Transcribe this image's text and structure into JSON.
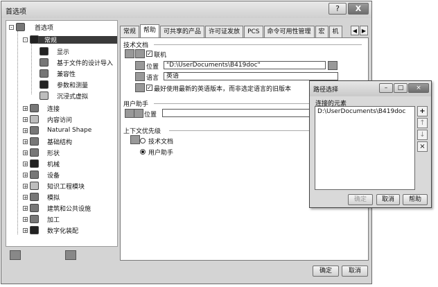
{
  "window": {
    "title": "首选项",
    "help_button": "?",
    "close_button": "X"
  },
  "tree": {
    "root_label": "首选项",
    "selected_label": "常规",
    "children": [
      "显示",
      "基于文件的设计导入",
      "兼容性",
      "参数和测量",
      "沉浸式虚拟"
    ],
    "items": [
      "连接",
      "内容访问",
      "Natural Shape",
      "基础结构",
      "形状",
      "机械",
      "设备",
      "知识工程模块",
      "模拟",
      "建筑和公共设施",
      "加工",
      "数字化装配"
    ]
  },
  "tabs": [
    "常规",
    "帮助",
    "可共享的产品",
    "许可证发放",
    "PCS",
    "命令可用性管理",
    "宏",
    "机"
  ],
  "tab_scroll": {
    "left": "◀",
    "right": "▶"
  },
  "sections": {
    "tech_docs": {
      "title": "技术文档",
      "connect_label": "联机",
      "location_label": "位置",
      "location_value": "\"D:\\UserDocuments\\B419doc\"",
      "language_label": "语言",
      "language_value": "英语",
      "english_label": "最好使用最新的英语版本，而非选定语言的旧版本"
    },
    "user_assistant": {
      "title": "用户助手",
      "location_label": "位置"
    },
    "context_priority": {
      "title": "上下文优先级",
      "option1": "技术文档",
      "option2": "用户助手"
    }
  },
  "buttons": {
    "ok": "确定",
    "cancel": "取消"
  },
  "path_dialog": {
    "title": "路径选择",
    "list_title": "连接的元素",
    "entry": "D:\\UserDocuments\\B419doc",
    "ok": "确定",
    "cancel": "取消",
    "help": "帮助",
    "side_buttons": [
      "+",
      "↑",
      "↓",
      "×"
    ]
  }
}
